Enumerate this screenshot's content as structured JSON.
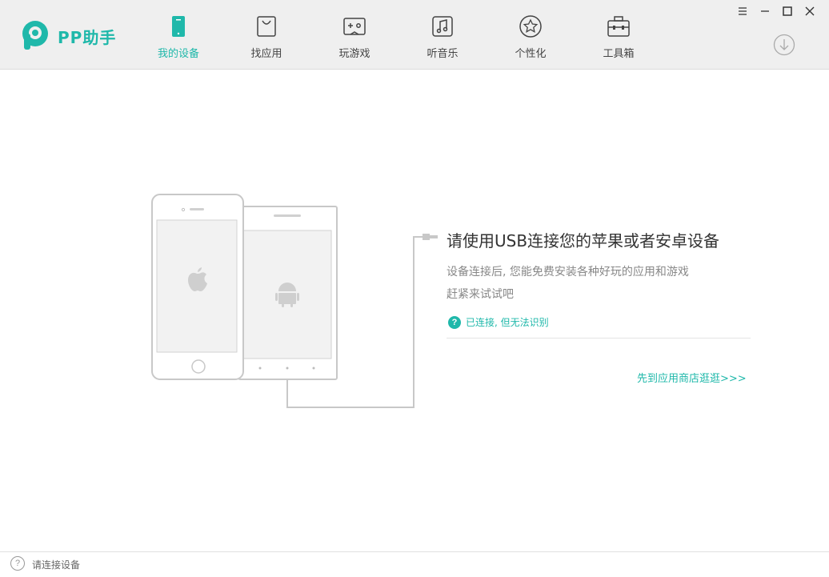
{
  "app": {
    "name": "PP助手",
    "accent_color": "#1fb8aa"
  },
  "nav": {
    "tabs": [
      {
        "label": "我的设备",
        "icon": "phone-icon",
        "active": true
      },
      {
        "label": "找应用",
        "icon": "shopping-bag-icon",
        "active": false
      },
      {
        "label": "玩游戏",
        "icon": "gamepad-icon",
        "active": false
      },
      {
        "label": "听音乐",
        "icon": "music-note-icon",
        "active": false
      },
      {
        "label": "个性化",
        "icon": "star-icon",
        "active": false
      },
      {
        "label": "工具箱",
        "icon": "toolbox-icon",
        "active": false
      }
    ]
  },
  "window_controls": [
    "menu-icon",
    "minimize-icon",
    "maximize-icon",
    "close-icon"
  ],
  "download_icon": "download-icon",
  "main": {
    "title": "请使用USB连接您的苹果或者安卓设备",
    "subtitle_line1": "设备连接后, 您能免费安装各种好玩的应用和游戏",
    "subtitle_line2": "赶紧来试试吧",
    "help_link": "已连接, 但无法识别",
    "help_icon_glyph": "?",
    "store_link": "先到应用商店逛逛>>>"
  },
  "status": {
    "text": "请连接设备",
    "icon_glyph": "?"
  }
}
